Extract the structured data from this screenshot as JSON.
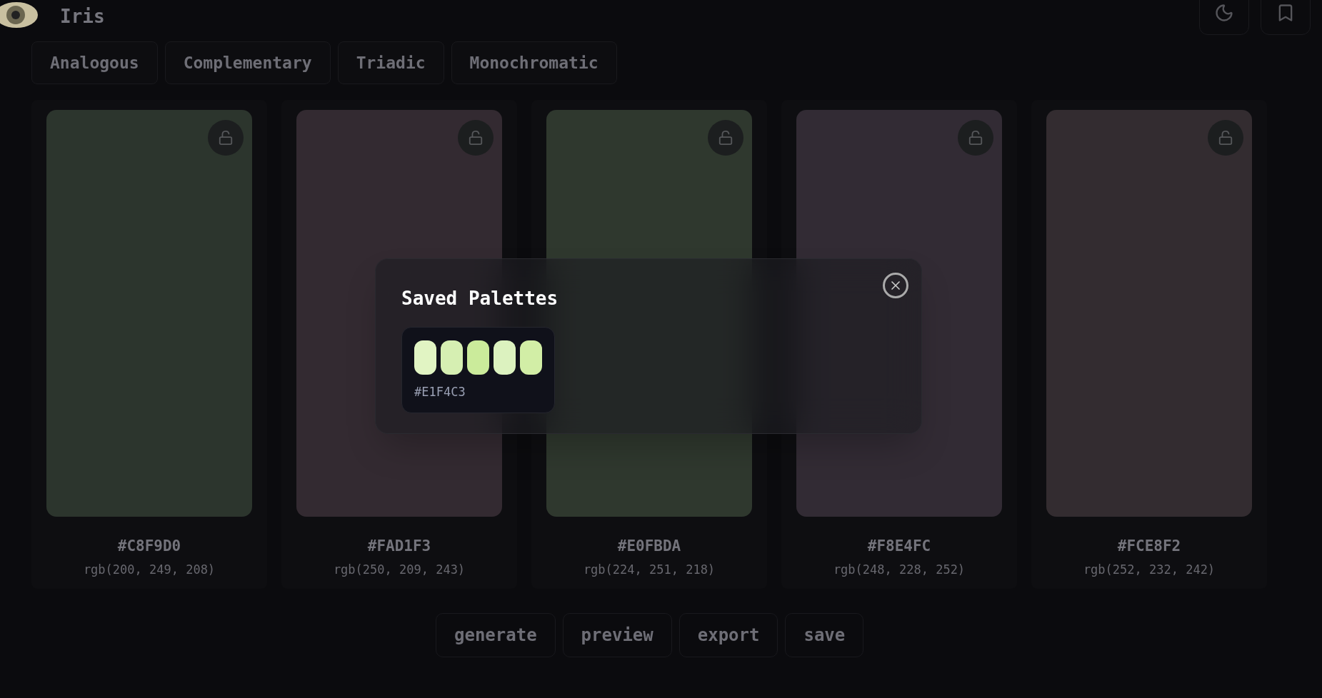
{
  "app": {
    "title": "Iris"
  },
  "tabs": [
    {
      "label": "Analogous",
      "selected": false
    },
    {
      "label": "Complementary",
      "selected": false
    },
    {
      "label": "Triadic",
      "selected": false
    },
    {
      "label": "Monochromatic",
      "selected": false
    }
  ],
  "swatches": [
    {
      "color": "#2c352d",
      "hex": "#C8F9D0",
      "rgb": "rgb(200, 249, 208)",
      "locked": false
    },
    {
      "color": "#332a31",
      "hex": "#FAD1F3",
      "rgb": "rgb(250, 209, 243)",
      "locked": false
    },
    {
      "color": "#2f382e",
      "hex": "#E0FBDA",
      "rgb": "rgb(224, 251, 218)",
      "locked": false
    },
    {
      "color": "#322b34",
      "hex": "#F8E4FC",
      "rgb": "rgb(248, 228, 252)",
      "locked": false
    },
    {
      "color": "#332c30",
      "hex": "#FCE8F2",
      "rgb": "rgb(252, 232, 242)",
      "locked": false
    }
  ],
  "actions": [
    "generate",
    "preview",
    "export",
    "save"
  ],
  "modal": {
    "title": "Saved Palettes",
    "palettes": [
      {
        "label": "#E1F4C3",
        "colors": [
          {
            "color": "#e1f4c3"
          },
          {
            "color": "#d6efb2"
          },
          {
            "color": "#cbeb9b"
          },
          {
            "color": "#dcf2bf"
          },
          {
            "color": "#d2eea6"
          }
        ]
      }
    ]
  }
}
